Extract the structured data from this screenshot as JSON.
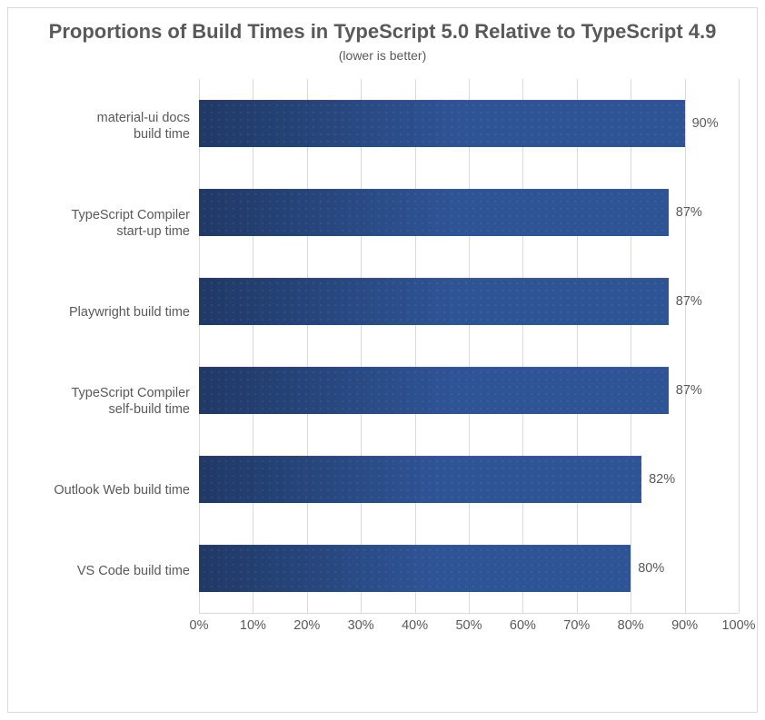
{
  "chart_data": {
    "type": "bar",
    "orientation": "horizontal",
    "title": "Proportions of Build Times in TypeScript 5.0\nRelative to TypeScript 4.9",
    "subtitle": "(lower is better)",
    "categories": [
      "material-ui docs\nbuild time",
      "TypeScript Compiler\nstart-up time",
      "Playwright build time",
      "TypeScript Compiler\nself-build time",
      "Outlook Web build time",
      "VS Code build time"
    ],
    "values": [
      90,
      87,
      87,
      87,
      82,
      80
    ],
    "value_labels": [
      "90%",
      "87%",
      "87%",
      "87%",
      "82%",
      "80%"
    ],
    "xlabel": "",
    "ylabel": "",
    "xlim": [
      0,
      100
    ],
    "x_ticks": [
      0,
      10,
      20,
      30,
      40,
      50,
      60,
      70,
      80,
      90,
      100
    ],
    "x_tick_labels": [
      "0%",
      "10%",
      "20%",
      "30%",
      "40%",
      "50%",
      "60%",
      "70%",
      "80%",
      "90%",
      "100%"
    ],
    "bar_color": "#2F5496",
    "grid": {
      "x": true,
      "y": false
    },
    "legend": false
  }
}
